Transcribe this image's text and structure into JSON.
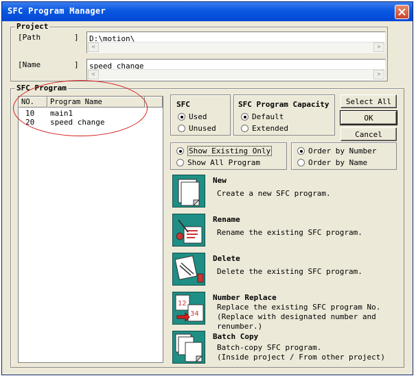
{
  "window": {
    "title": "SFC Program Manager"
  },
  "project": {
    "legend": "Project",
    "path_label": "[Path",
    "path_bracket": "]",
    "path_value": "D:\\motion\\",
    "name_label": "[Name",
    "name_bracket": "]",
    "name_value": "speed change"
  },
  "sfc_program": {
    "legend": "SFC Program",
    "columns": [
      "NO.",
      "Program Name"
    ],
    "rows": [
      {
        "no": "10",
        "name": "main1"
      },
      {
        "no": "20",
        "name": "speed change"
      }
    ]
  },
  "sfc_group": {
    "title": "SFC",
    "used": "Used",
    "unused": "Unused",
    "selected": "used"
  },
  "capacity_group": {
    "title": "SFC Program Capacity",
    "default": "Default",
    "extended": "Extended",
    "selected": "default"
  },
  "buttons": {
    "select_all": "Select All",
    "ok": "OK",
    "cancel": "Cancel"
  },
  "show_group": {
    "show_existing": "Show Existing Only",
    "show_all": "Show All Program",
    "selected": "show_existing"
  },
  "order_group": {
    "by_number": "Order by Number",
    "by_name": "Order by Name",
    "selected": "by_number"
  },
  "actions": [
    {
      "id": "new",
      "title": "New",
      "desc": "Create a new SFC program.",
      "icon": "new-document-icon"
    },
    {
      "id": "rename",
      "title": "Rename",
      "desc": "Rename the existing SFC program.",
      "icon": "rename-icon"
    },
    {
      "id": "delete",
      "title": "Delete",
      "desc": "Delete the existing SFC program.",
      "icon": "delete-icon"
    },
    {
      "id": "number-replace",
      "title": "Number Replace",
      "desc": "Replace the existing SFC program No.\n(Replace with designated number and\nrenumber.)",
      "icon": "number-replace-icon",
      "icon_text_a": "12",
      "icon_text_b": "34"
    },
    {
      "id": "batch-copy",
      "title": "Batch Copy",
      "desc": "Batch-copy SFC program.\n(Inside project / From other project)",
      "icon": "batch-copy-icon"
    }
  ],
  "colors": {
    "titlebar": "#0a58e0",
    "icon_bg": "#1f8f85",
    "highlight_ellipse": "#d42020"
  }
}
